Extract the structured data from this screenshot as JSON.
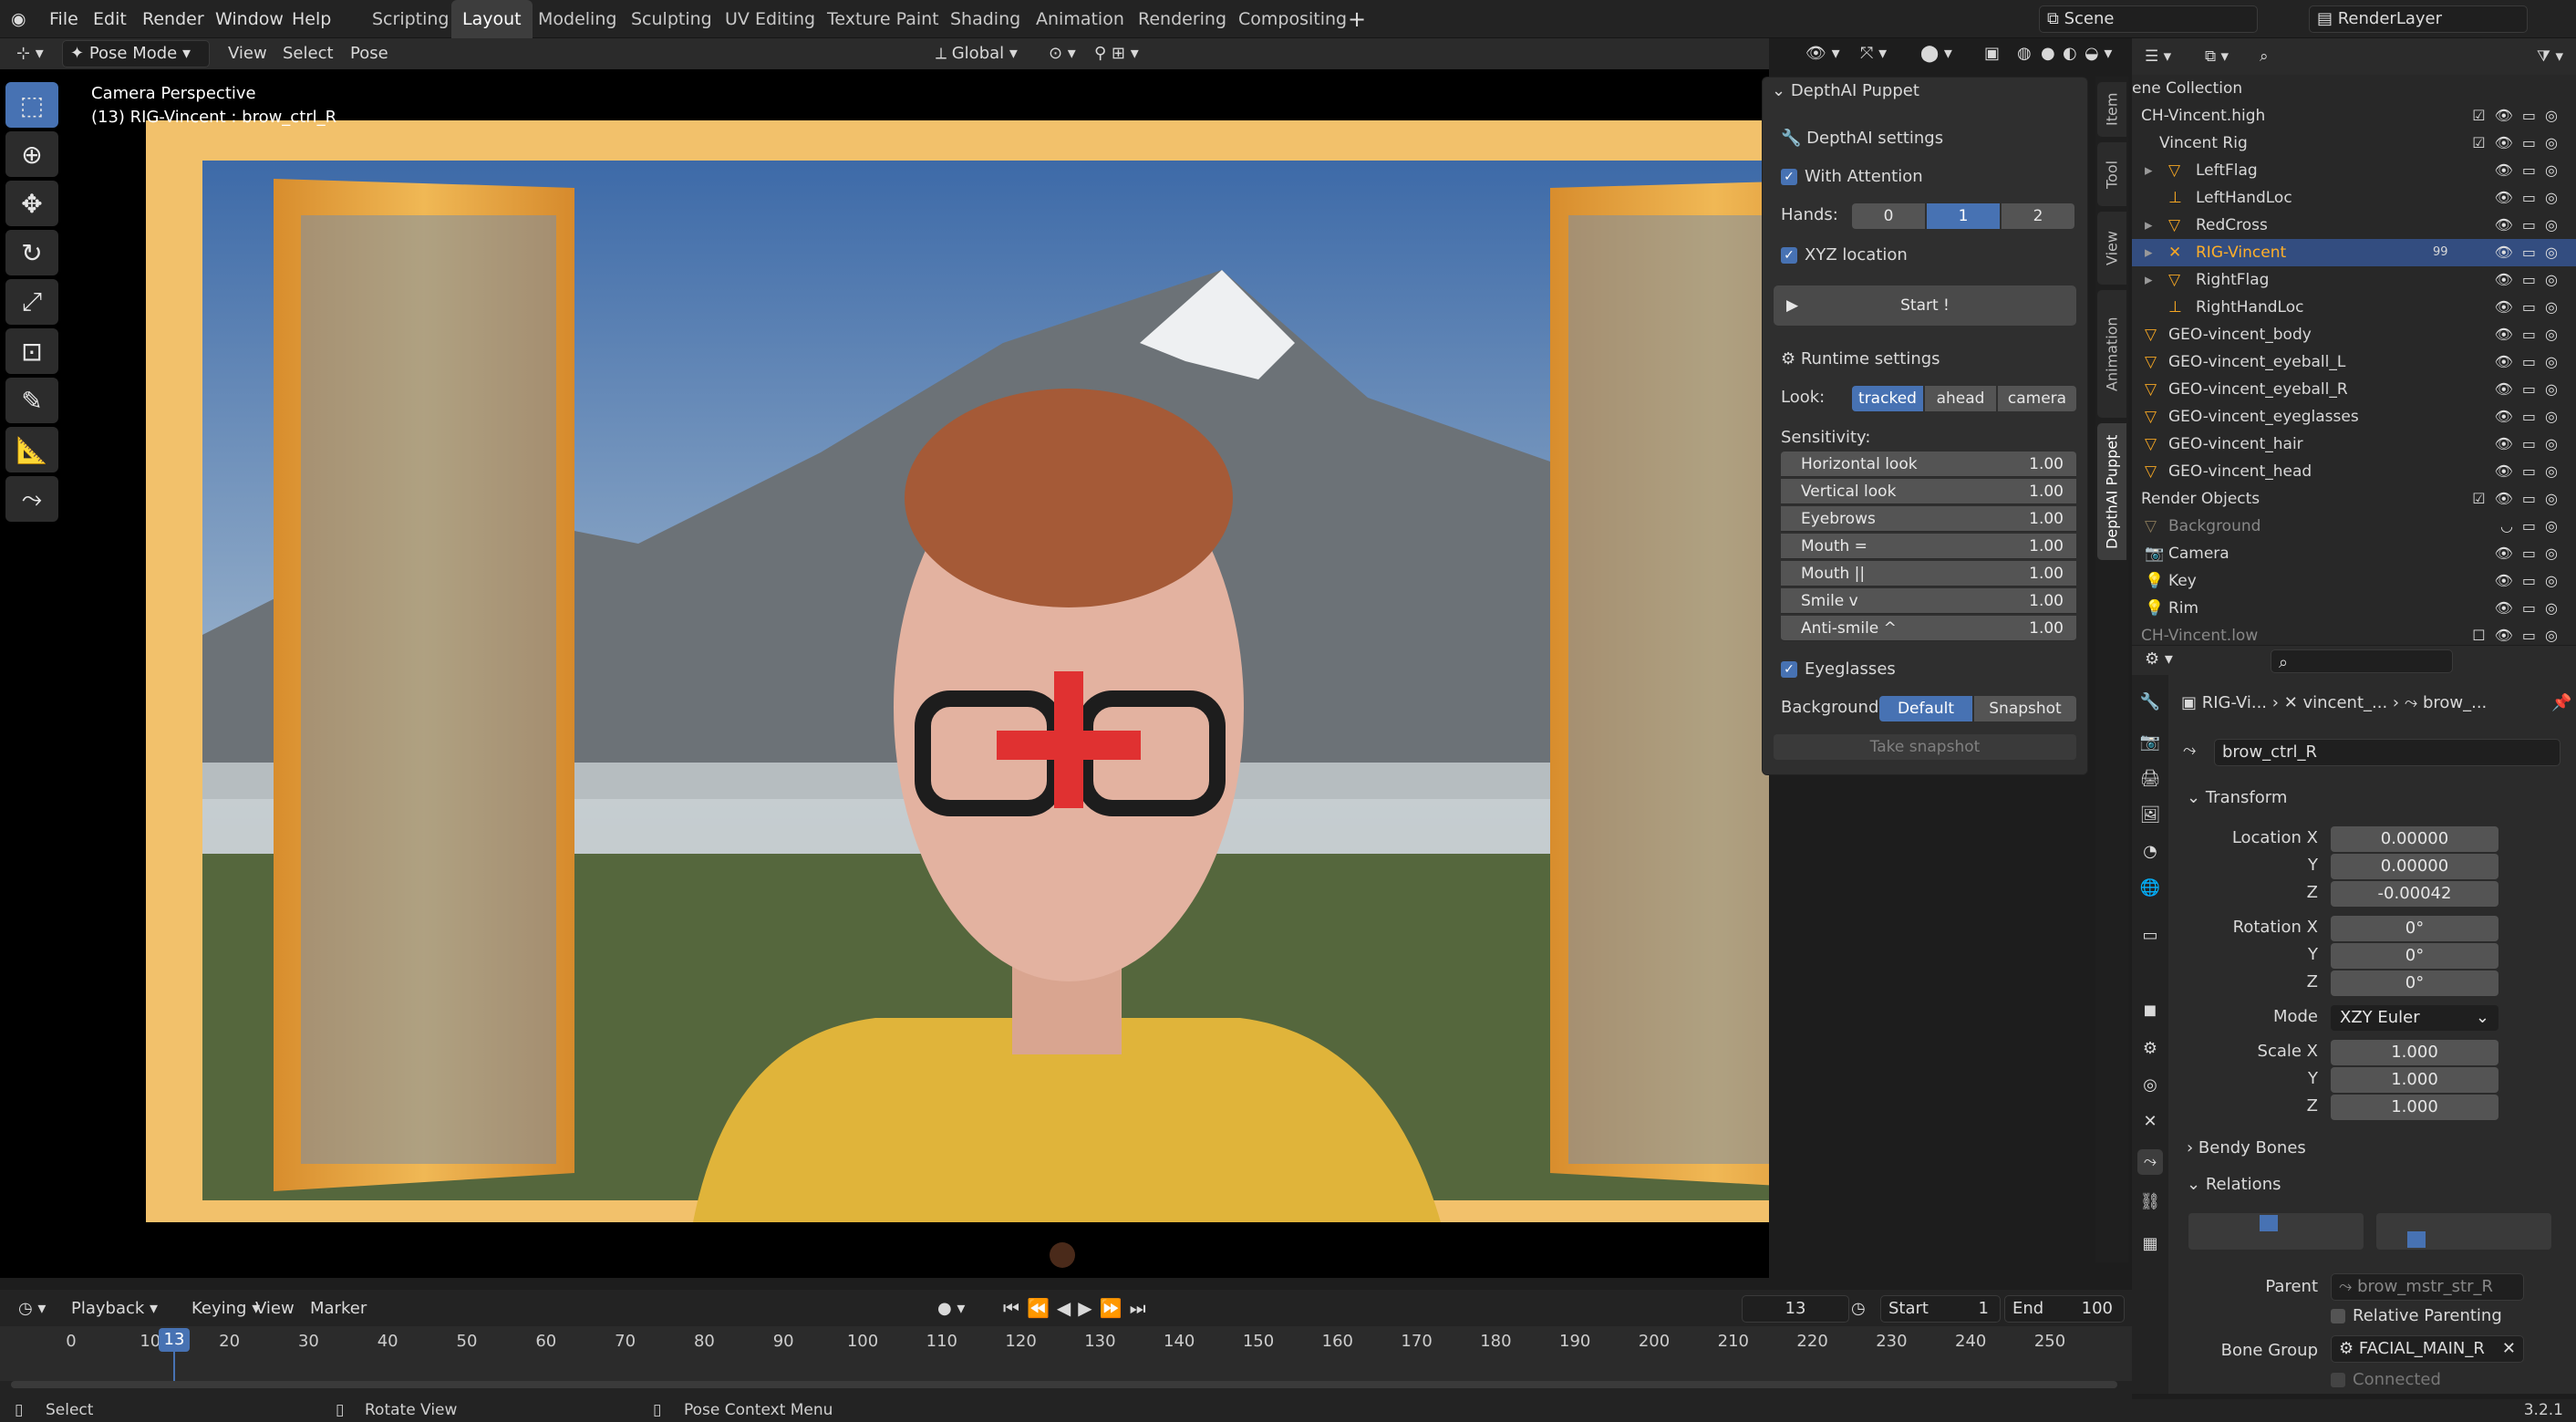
{
  "top_menu": {
    "file": "File",
    "edit": "Edit",
    "render": "Render",
    "window": "Window",
    "help": "Help"
  },
  "workspaces": [
    "Scripting",
    "Layout",
    "Modeling",
    "Sculpting",
    "UV Editing",
    "Texture Paint",
    "Shading",
    "Animation",
    "Rendering",
    "Compositing"
  ],
  "scene": "Scene",
  "render_layer": "RenderLayer",
  "viewport_header": {
    "mode": "Pose Mode",
    "view": "View",
    "select": "Select",
    "pose": "Pose",
    "orientation": "Global"
  },
  "viewport_overlay": {
    "title": "Camera Perspective",
    "subtitle": "(13) RIG-Vincent : brow_ctrl_R"
  },
  "depthai": {
    "title": "DepthAI Puppet",
    "settings": "DepthAI settings",
    "with_attention": "With Attention",
    "hands_label": "Hands:",
    "hands": [
      "0",
      "1",
      "2"
    ],
    "xyz": "XYZ location",
    "start": "Start !",
    "runtime": "Runtime settings",
    "look_label": "Look:",
    "look": [
      "tracked",
      "ahead",
      "camera"
    ],
    "sensitivity": "Sensitivity:",
    "sliders": [
      {
        "label": "Horizontal look",
        "value": "1.00"
      },
      {
        "label": "Vertical look",
        "value": "1.00"
      },
      {
        "label": "Eyebrows",
        "value": "1.00"
      },
      {
        "label": "Mouth =",
        "value": "1.00"
      },
      {
        "label": "Mouth ||",
        "value": "1.00"
      },
      {
        "label": "Smile v",
        "value": "1.00"
      },
      {
        "label": "Anti-smile ^",
        "value": "1.00"
      }
    ],
    "eyeglasses": "Eyeglasses",
    "bg_label": "Background:",
    "bg_options": [
      "Default",
      "Snapshot"
    ],
    "take_snapshot": "Take snapshot"
  },
  "side_tabs": [
    "Item",
    "Tool",
    "View",
    "Animation",
    "DepthAI Puppet"
  ],
  "outliner": {
    "rows": [
      "ene Collection",
      "CH-Vincent.high",
      "Vincent Rig",
      "LeftFlag",
      "LeftHandLoc",
      "RedCross",
      "RIG-Vincent",
      "RightFlag",
      "RightHandLoc",
      "GEO-vincent_body",
      "GEO-vincent_eyeball_L",
      "GEO-vincent_eyeball_R",
      "GEO-vincent_eyeglasses",
      "GEO-vincent_hair",
      "GEO-vincent_head",
      "Render Objects",
      "Background",
      "Camera",
      "Key",
      "Rim",
      "CH-Vincent.low"
    ],
    "rig_badge": "99"
  },
  "properties": {
    "breadcrumb": [
      "RIG-Vi...",
      "vincent_...",
      "brow_..."
    ],
    "bone_name": "brow_ctrl_R",
    "transform": "Transform",
    "location": [
      {
        "axis": "Location X",
        "value": "0.00000"
      },
      {
        "axis": "Y",
        "value": "0.00000"
      },
      {
        "axis": "Z",
        "value": "-0.00042"
      }
    ],
    "rotation": [
      {
        "axis": "Rotation X",
        "value": "0°"
      },
      {
        "axis": "Y",
        "value": "0°"
      },
      {
        "axis": "Z",
        "value": "0°"
      }
    ],
    "mode_label": "Mode",
    "mode_value": "XZY Euler",
    "scale": [
      {
        "axis": "Scale X",
        "value": "1.000"
      },
      {
        "axis": "Y",
        "value": "1.000"
      },
      {
        "axis": "Z",
        "value": "1.000"
      }
    ],
    "bendy": "Bendy Bones",
    "relations": "Relations",
    "parent_label": "Parent",
    "parent_value": "brow_mstr_str_R",
    "relative_parenting": "Relative Parenting",
    "bone_group_label": "Bone Group",
    "bone_group_value": "FACIAL_MAIN_R",
    "connected": "Connected"
  },
  "timeline": {
    "playback": "Playback",
    "keying": "Keying",
    "view": "View",
    "marker": "Marker",
    "current_frame": "13",
    "start_label": "Start",
    "start": "1",
    "end_label": "End",
    "end": "100",
    "ticks": [
      "0",
      "10",
      "20",
      "30",
      "40",
      "50",
      "60",
      "70",
      "80",
      "90",
      "100",
      "110",
      "120",
      "130",
      "140",
      "150",
      "160",
      "170",
      "180",
      "190",
      "200",
      "210",
      "220",
      "230",
      "240",
      "250"
    ]
  },
  "status": {
    "select": "Select",
    "rotate": "Rotate View",
    "context": "Pose Context Menu",
    "version": "3.2.1"
  }
}
